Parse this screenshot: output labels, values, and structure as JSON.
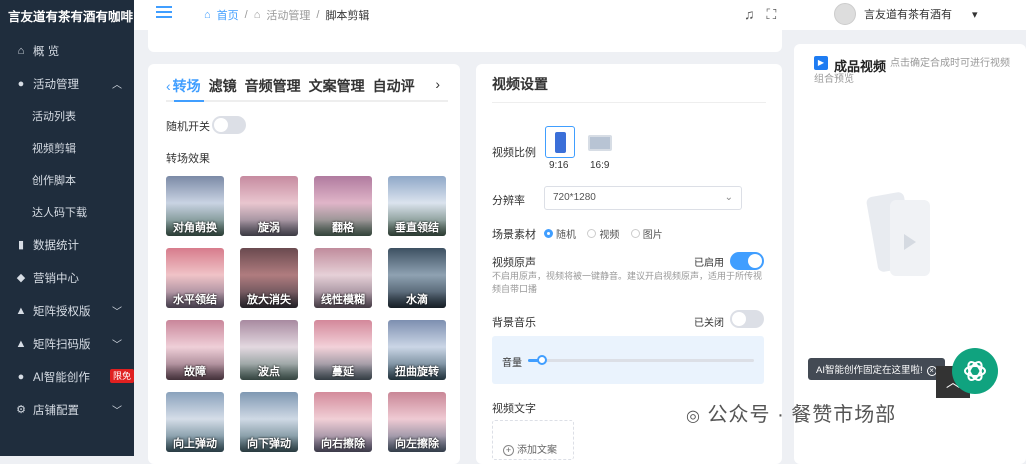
{
  "sidebar": {
    "brand": "言友道有茶有酒有咖啡",
    "items": [
      {
        "icon": "home-icon",
        "glyph": "⌂",
        "label": "概 览"
      },
      {
        "icon": "activity-icon",
        "glyph": "●",
        "label": "活动管理",
        "expanded": true
      },
      {
        "label": "活动列表"
      },
      {
        "label": "视频剪辑"
      },
      {
        "label": "创作脚本"
      },
      {
        "label": "达人码下载"
      },
      {
        "icon": "bar-chart-icon",
        "glyph": "▮",
        "label": "数据统计"
      },
      {
        "icon": "layers-icon",
        "glyph": "◆",
        "label": "营销中心"
      },
      {
        "icon": "person-icon",
        "glyph": "▲",
        "label": "矩阵授权版"
      },
      {
        "icon": "person-icon",
        "glyph": "▲",
        "label": "矩阵扫码版"
      },
      {
        "icon": "ai-icon",
        "glyph": "●",
        "label": "AI智能创作",
        "badge": "限免"
      },
      {
        "icon": "settings-icon",
        "glyph": "⚙",
        "label": "店铺配置"
      }
    ]
  },
  "topbar": {
    "breadcrumb": [
      "首页",
      "活动管理",
      "脚本剪辑"
    ],
    "user_name": "言友道有茶有酒有"
  },
  "left_panel": {
    "tabs": [
      "转场",
      "滤镜",
      "音频管理",
      "文案管理",
      "自动评"
    ],
    "active_tab": "转场",
    "random_switch_label": "随机开关",
    "random_switch_on": false,
    "effects_title": "转场效果",
    "effects": [
      "对角萌换",
      "旋涡",
      "翻格",
      "垂直领结",
      "水平领结",
      "放大消失",
      "线性模糊",
      "水滴",
      "故障",
      "波点",
      "蔓延",
      "扭曲旋转",
      "向上弹动",
      "向下弹动",
      "向右擦除",
      "向左擦除"
    ]
  },
  "video_settings": {
    "title": "视频设置",
    "ratio_label": "视频比例",
    "ratios": [
      "9:16",
      "16:9"
    ],
    "selected_ratio": "9:16",
    "resolution_label": "分辨率",
    "resolution_value": "720*1280",
    "material_label": "场景素材",
    "material_options": [
      "随机",
      "视频",
      "图片"
    ],
    "material_selected": "随机",
    "original_sound_label": "视频原声",
    "original_sound_state": "已启用",
    "original_sound_on": true,
    "original_sound_desc": "不启用原声，视频将被一键静音。建议开启视频原声，适用于所传视频自带口播",
    "bgm_label": "背景音乐",
    "bgm_state": "已关闭",
    "bgm_on": false,
    "volume_label": "音量",
    "volume_value": 0.06,
    "video_text_label": "视频文字",
    "add_text_label": "添加文案"
  },
  "preview": {
    "title": "成品视频",
    "hint": "点击确定合成时可进行视频组合预览"
  },
  "tooltip": "AI智能创作固定在这里啦!",
  "watermark": "公众号 · 餐赞市场部"
}
